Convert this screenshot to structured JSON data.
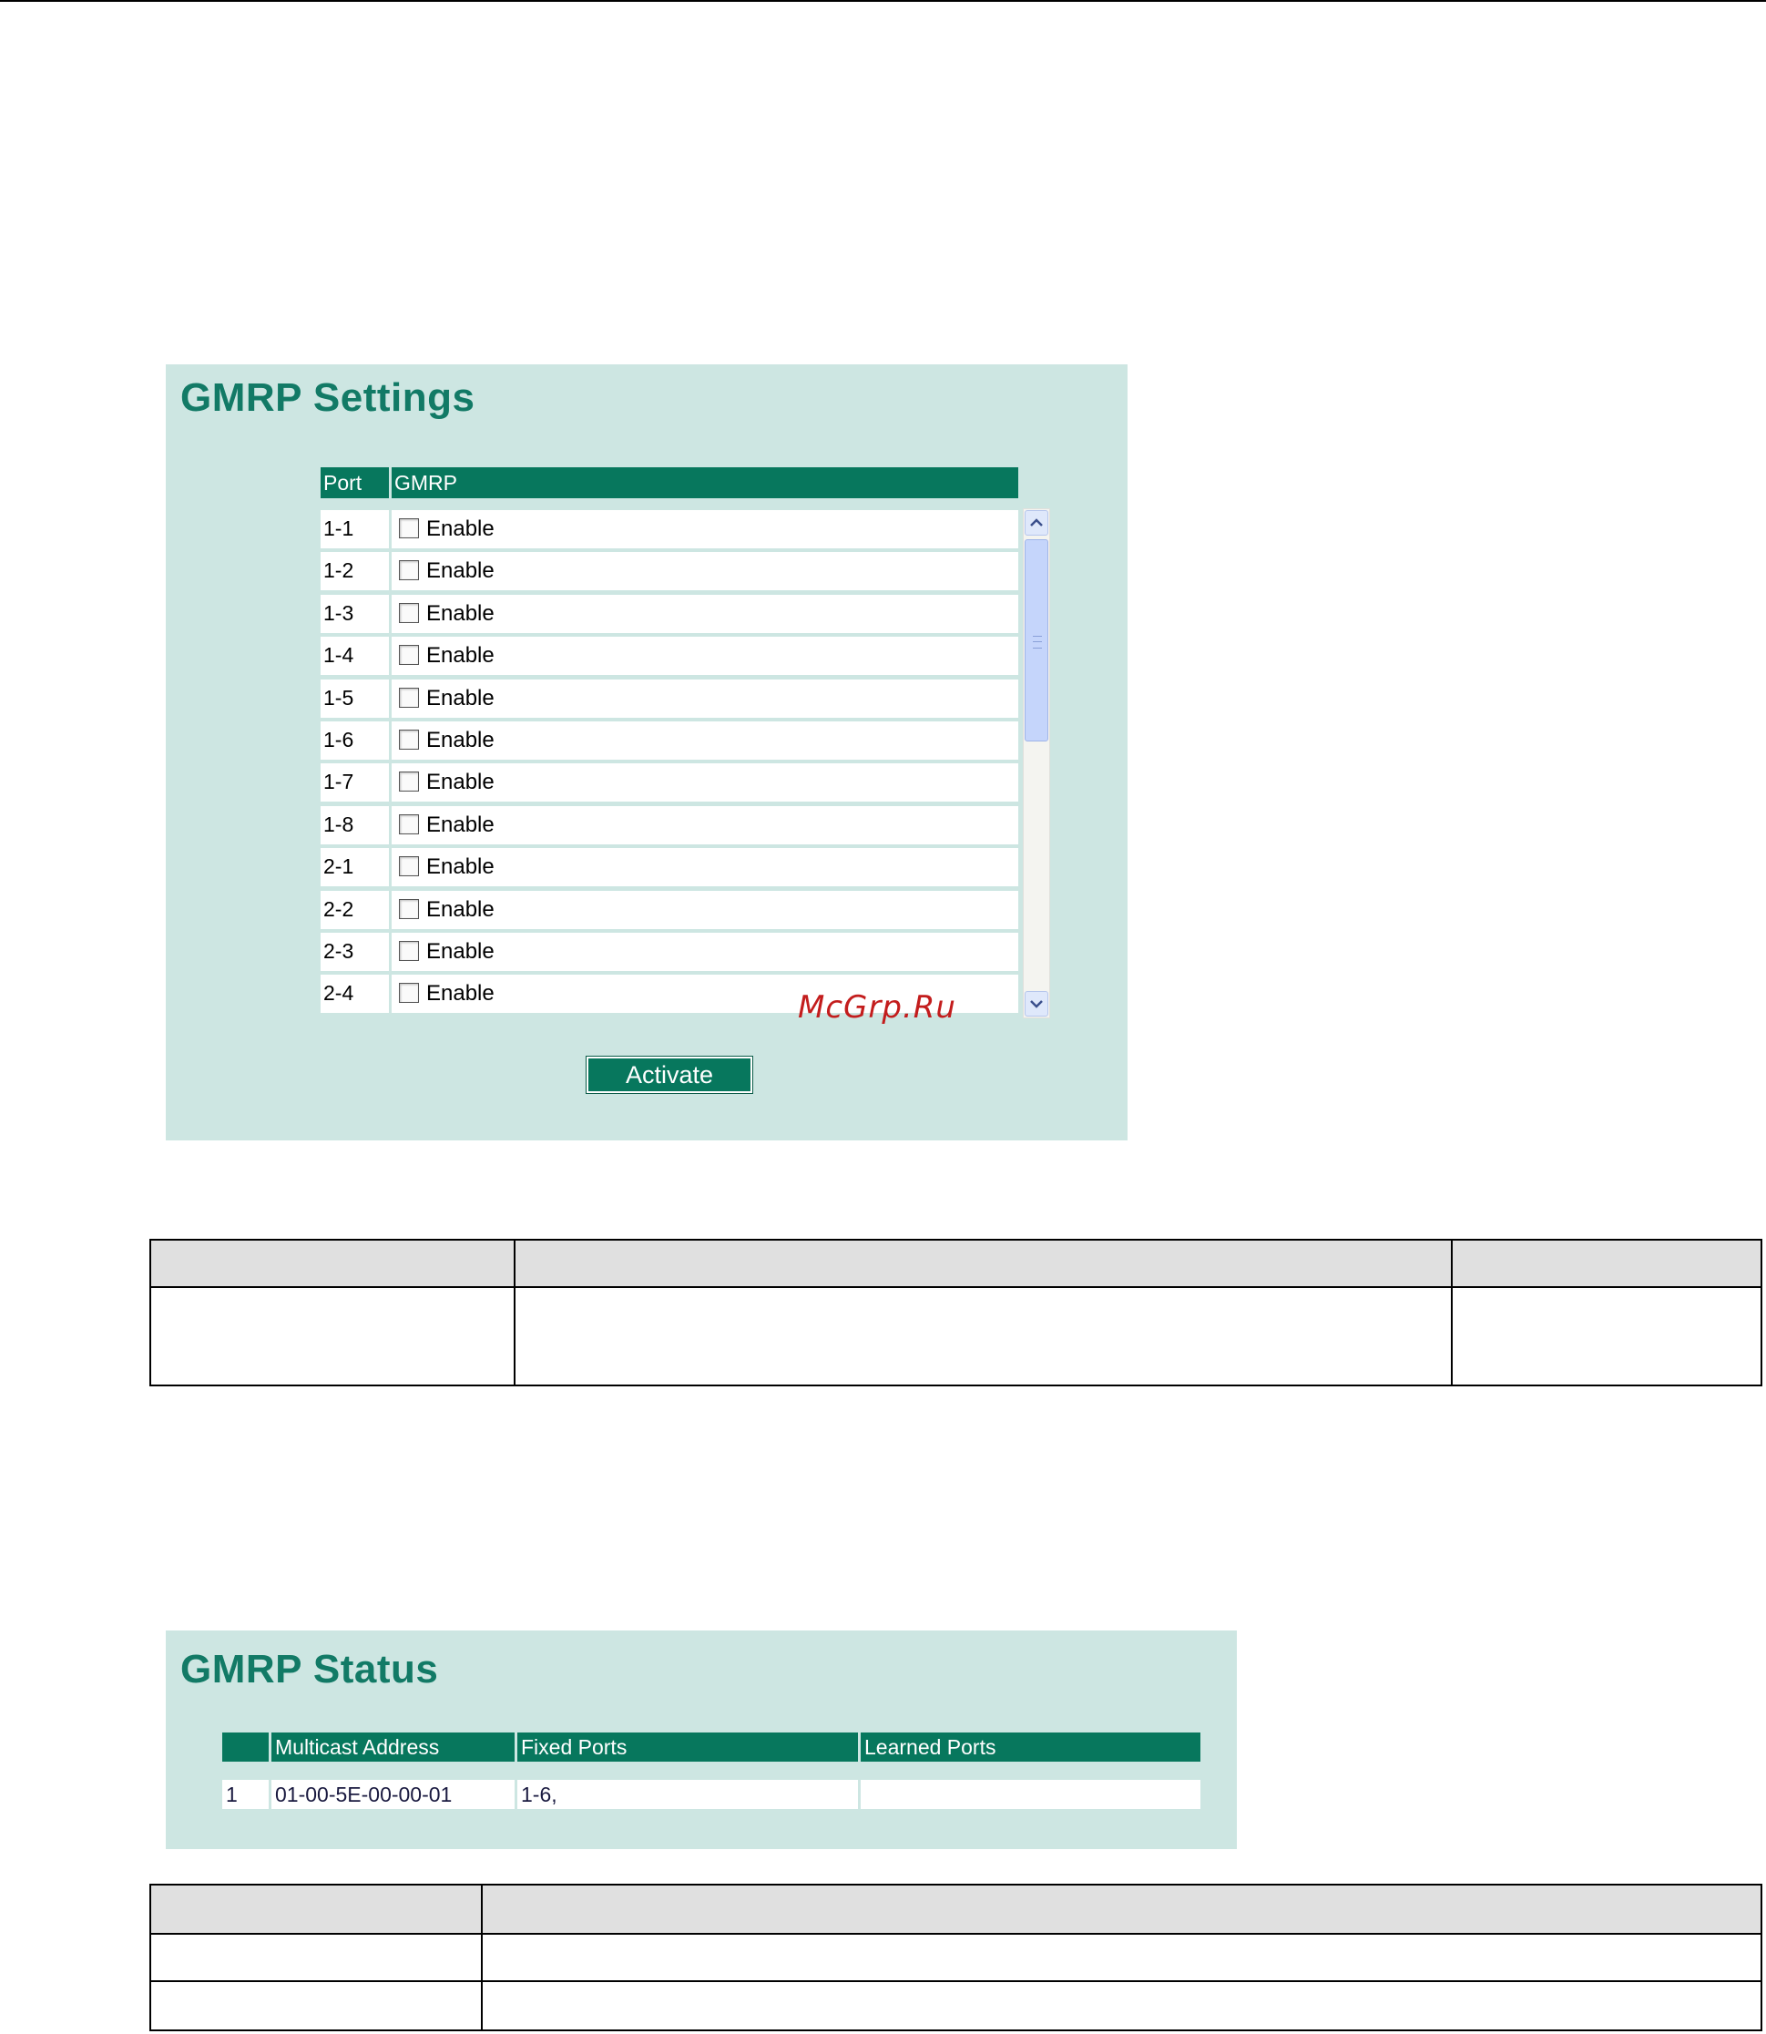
{
  "settings": {
    "title": "GMRP Settings",
    "columns": {
      "port": "Port",
      "gmrp": "GMRP"
    },
    "rows": [
      {
        "port": "1-1",
        "label": "Enable",
        "checked": false
      },
      {
        "port": "1-2",
        "label": "Enable",
        "checked": false
      },
      {
        "port": "1-3",
        "label": "Enable",
        "checked": false
      },
      {
        "port": "1-4",
        "label": "Enable",
        "checked": false
      },
      {
        "port": "1-5",
        "label": "Enable",
        "checked": false
      },
      {
        "port": "1-6",
        "label": "Enable",
        "checked": false
      },
      {
        "port": "1-7",
        "label": "Enable",
        "checked": false
      },
      {
        "port": "1-8",
        "label": "Enable",
        "checked": false
      },
      {
        "port": "2-1",
        "label": "Enable",
        "checked": false
      },
      {
        "port": "2-2",
        "label": "Enable",
        "checked": false
      },
      {
        "port": "2-3",
        "label": "Enable",
        "checked": false
      },
      {
        "port": "2-4",
        "label": "Enable",
        "checked": false
      }
    ],
    "activate_label": "Activate"
  },
  "watermark": "McGrp.Ru",
  "status": {
    "title": "GMRP Status",
    "columns": {
      "index": "",
      "address": "Multicast Address",
      "fixed": "Fixed Ports",
      "learned": "Learned Ports"
    },
    "rows": [
      {
        "index": "1",
        "address": "01-00-5E-00-00-01",
        "fixed": "1-6,",
        "learned": ""
      }
    ]
  },
  "colors": {
    "panel_bg": "#cde6e2",
    "header_green": "#07775d",
    "title_green": "#127a66",
    "watermark_red": "#c31d1d"
  }
}
